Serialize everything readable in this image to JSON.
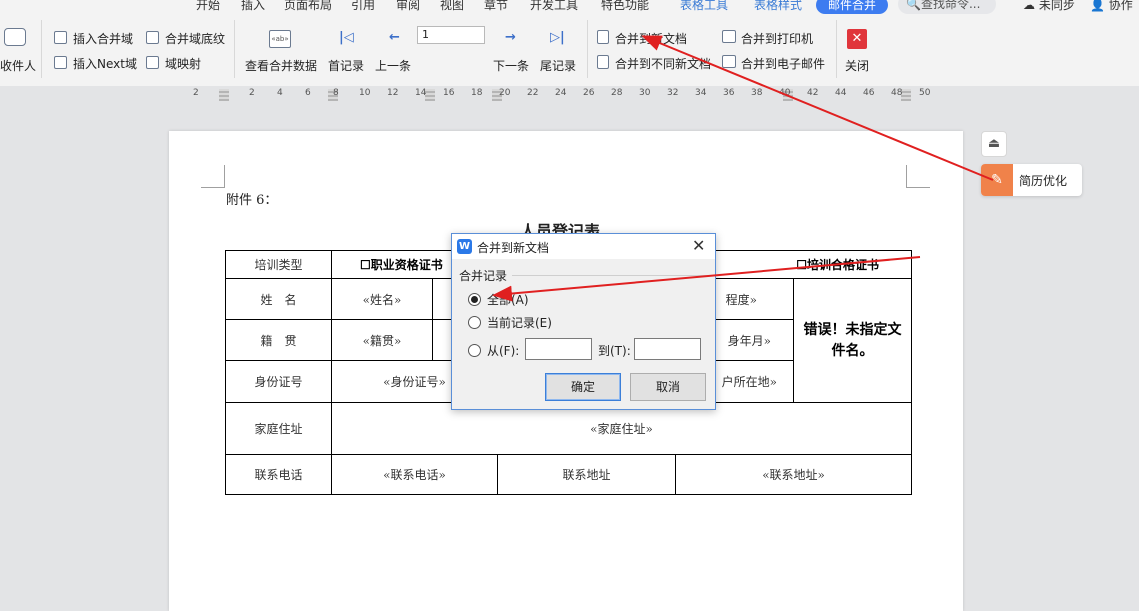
{
  "menubar": {
    "tabs": [
      "开始",
      "插入",
      "页面布局",
      "引用",
      "审阅",
      "视图",
      "章节",
      "开发工具",
      "特色功能"
    ],
    "context_tabs": [
      "表格工具",
      "表格样式"
    ],
    "active_tab": "邮件合并",
    "search_placeholder": "查找命令...",
    "sync_label": "未同步",
    "collab_label": "协作"
  },
  "ribbon": {
    "recipients_label": "收件人",
    "insert_field": "插入合并域",
    "insert_next": "插入Next域",
    "merge_shading": "合并域底纹",
    "field_mapping": "域映射",
    "view_data": "查看合并数据",
    "first_record": "首记录",
    "prev_record": "上一条",
    "record_number": "1",
    "next_record": "下一条",
    "last_record": "尾记录",
    "merge_new_doc": "合并到新文档",
    "merge_diff_docs": "合并到不同新文档",
    "merge_printer": "合并到打印机",
    "merge_email": "合并到电子邮件",
    "close": "关闭"
  },
  "ruler": {
    "ticks": [
      "2",
      "2",
      "4",
      "6",
      "8",
      "10",
      "12",
      "14",
      "16",
      "18",
      "20",
      "22",
      "24",
      "26",
      "28",
      "30",
      "32",
      "34",
      "36",
      "38",
      "40",
      "42",
      "44",
      "46",
      "48",
      "50"
    ]
  },
  "document": {
    "attachment": "附件 6：",
    "title": "人员登记表",
    "rows": {
      "training_type": "培训类型",
      "cert_vocational": "☐职业资格证书",
      "cert_training": "☐培训合格证书",
      "name": "姓　名",
      "name_field": "«姓名»",
      "education_field": "程度»",
      "error_text": "错误！未指定文件名。",
      "native_place": "籍　贯",
      "native_field": "«籍贯»",
      "birth_field": "身年月»",
      "id_number": "身份证号",
      "id_field": "«身份证号»",
      "location_field": "户所在地»",
      "home_address": "家庭住址",
      "home_field": "«家庭住址»",
      "phone": "联系电话",
      "phone_field": "«联系电话»",
      "contact_address": "联系地址",
      "contact_field": "«联系地址»"
    }
  },
  "side_panel": {
    "resume_label": "简历优化"
  },
  "dialog": {
    "title": "合并到新文档",
    "group_label": "合并记录",
    "opt_all": "全部(A)",
    "opt_current": "当前记录(E)",
    "opt_from": "从(F):",
    "to_label": "到(T):",
    "from_value": "",
    "to_value": "",
    "selected": "all",
    "ok": "确定",
    "cancel": "取消"
  },
  "colors": {
    "accent_blue": "#3d7cf0",
    "annotation_red": "#e02020",
    "resume_orange": "#f0824a",
    "close_red": "#e0353b"
  }
}
